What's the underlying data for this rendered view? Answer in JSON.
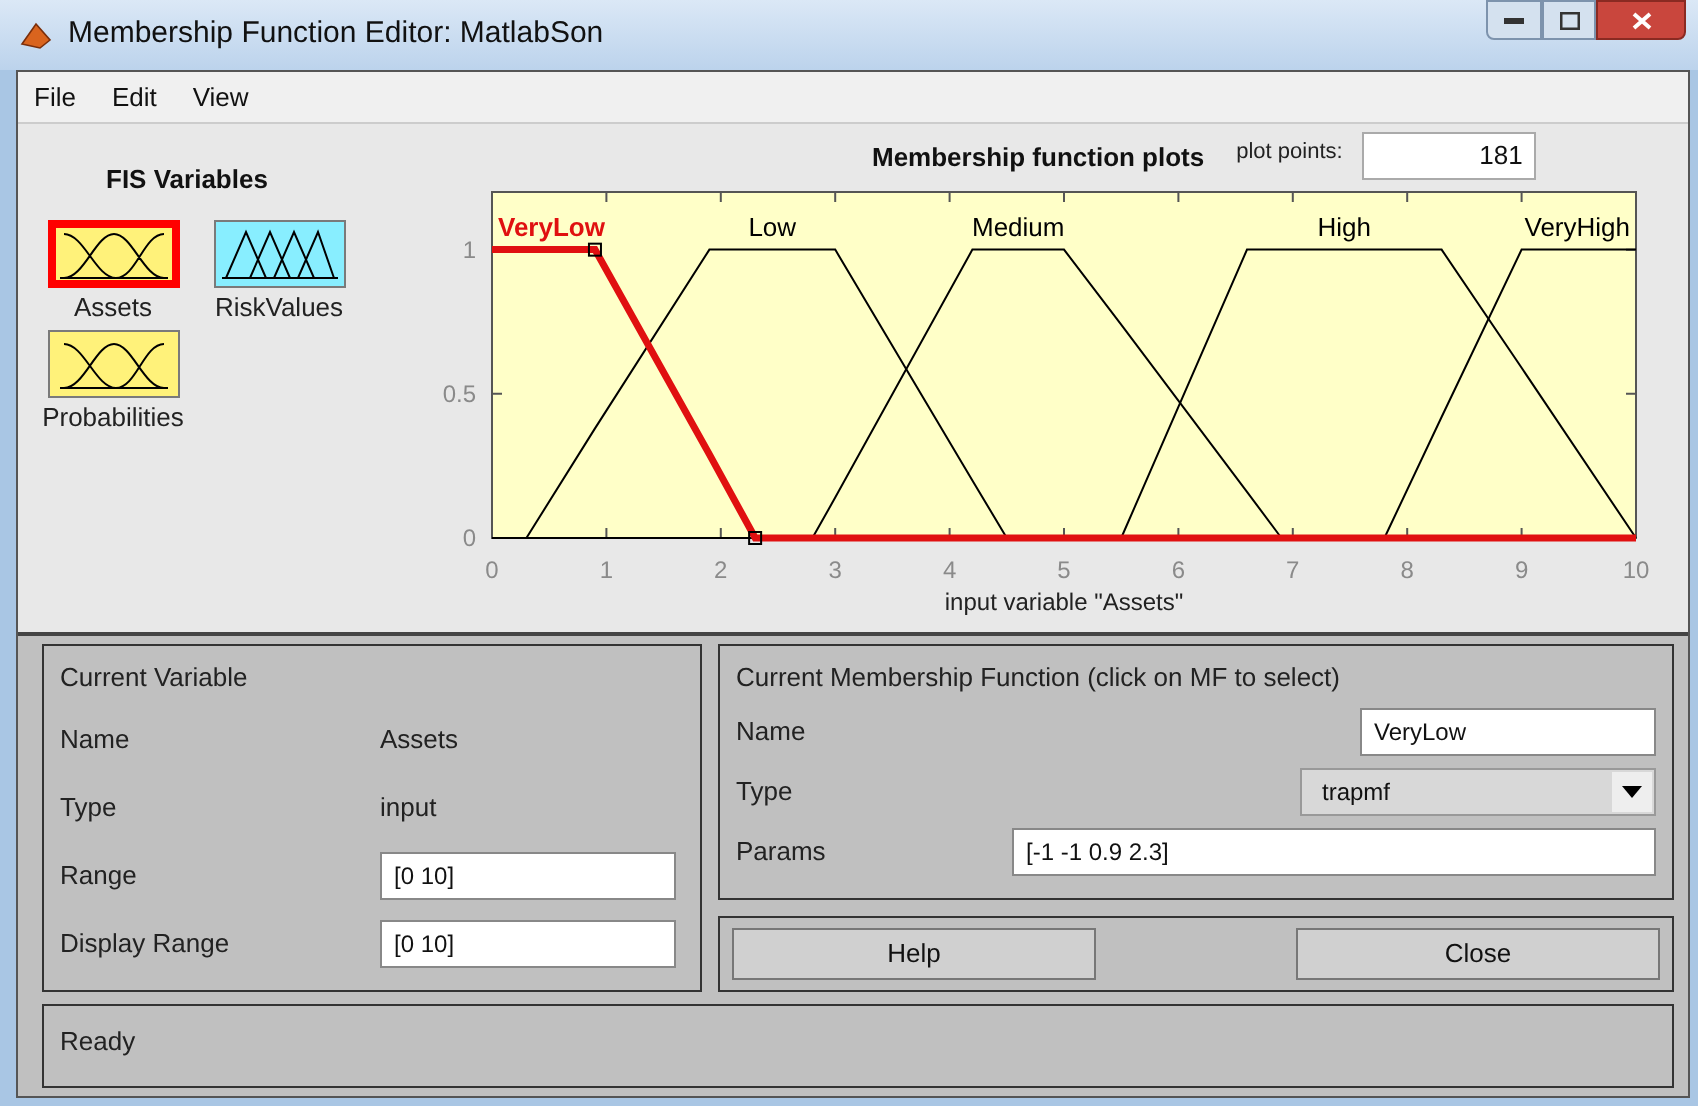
{
  "window": {
    "title": "Membership Function Editor: MatlabSon"
  },
  "menu": [
    "File",
    "Edit",
    "View"
  ],
  "fis_variables": {
    "title": "FIS Variables",
    "items": [
      {
        "label": "Assets",
        "kind": "input",
        "selected": true
      },
      {
        "label": "RiskValues",
        "kind": "output",
        "selected": false
      },
      {
        "label": "Probabilities",
        "kind": "input",
        "selected": false
      }
    ]
  },
  "plot": {
    "plot_points_label": "plot points:",
    "plot_points": "181",
    "curve_states": [
      {
        "selected": true
      },
      {
        "selected": false
      },
      {
        "selected": false
      },
      {
        "selected": false
      },
      {
        "selected": false
      }
    ],
    "chart_data": {
      "type": "line",
      "title": "Membership function plots",
      "xlabel": "input variable \"Assets\"",
      "x": [
        0,
        0.3,
        0.9,
        1.9,
        2.3,
        2.8,
        3,
        4.2,
        4.5,
        5,
        5.5,
        6.6,
        6.9,
        7.8,
        8.3,
        9,
        10
      ],
      "series": [
        {
          "name": "VeryLow",
          "color": "#e01010",
          "values": [
            1,
            1,
            1,
            0.29,
            0,
            0,
            0,
            0,
            0,
            0,
            0,
            0,
            0,
            0,
            0,
            0,
            0
          ]
        },
        {
          "name": "Low",
          "color": "#000000",
          "values": [
            null,
            0,
            0.38,
            1,
            1,
            1,
            1,
            0.2,
            0,
            null,
            null,
            null,
            null,
            null,
            null,
            null,
            null
          ]
        },
        {
          "name": "Medium",
          "color": "#000000",
          "values": [
            null,
            null,
            null,
            null,
            null,
            0,
            0.14,
            1,
            1,
            1,
            0.74,
            0.16,
            0,
            null,
            null,
            null,
            null
          ]
        },
        {
          "name": "High",
          "color": "#000000",
          "values": [
            null,
            null,
            null,
            null,
            null,
            null,
            null,
            null,
            null,
            null,
            0,
            1,
            1,
            1,
            1,
            0.59,
            0
          ]
        },
        {
          "name": "VeryHigh",
          "color": "#000000",
          "values": [
            null,
            null,
            null,
            null,
            null,
            null,
            null,
            null,
            null,
            null,
            null,
            null,
            null,
            0,
            0.42,
            1,
            1
          ]
        }
      ],
      "xlim": [
        0,
        10
      ],
      "ylim": [
        0,
        1.2
      ],
      "xticks": [
        0,
        1,
        2,
        3,
        4,
        5,
        6,
        7,
        8,
        9,
        10
      ],
      "yticks": [
        0,
        0.5,
        1
      ]
    }
  },
  "current_variable": {
    "title": "Current Variable",
    "rows": [
      {
        "label": "Name",
        "value": "Assets",
        "kind": "text"
      },
      {
        "label": "Type",
        "value": "input",
        "kind": "text"
      },
      {
        "label": "Range",
        "value": "[0 10]",
        "kind": "field"
      },
      {
        "label": "Display Range",
        "value": "[0 10]",
        "kind": "field"
      }
    ]
  },
  "current_mf": {
    "title": "Current Membership Function (click on MF to select)",
    "rows": [
      {
        "label": "Name",
        "value": "VeryLow",
        "kind": "field"
      },
      {
        "label": "Type",
        "value": "trapmf",
        "kind": "dropdown"
      },
      {
        "label": "Params",
        "value": "[-1 -1 0.9 2.3]",
        "kind": "wide_field"
      }
    ]
  },
  "buttons": [
    "Help",
    "Close"
  ],
  "status_bar": "Ready"
}
